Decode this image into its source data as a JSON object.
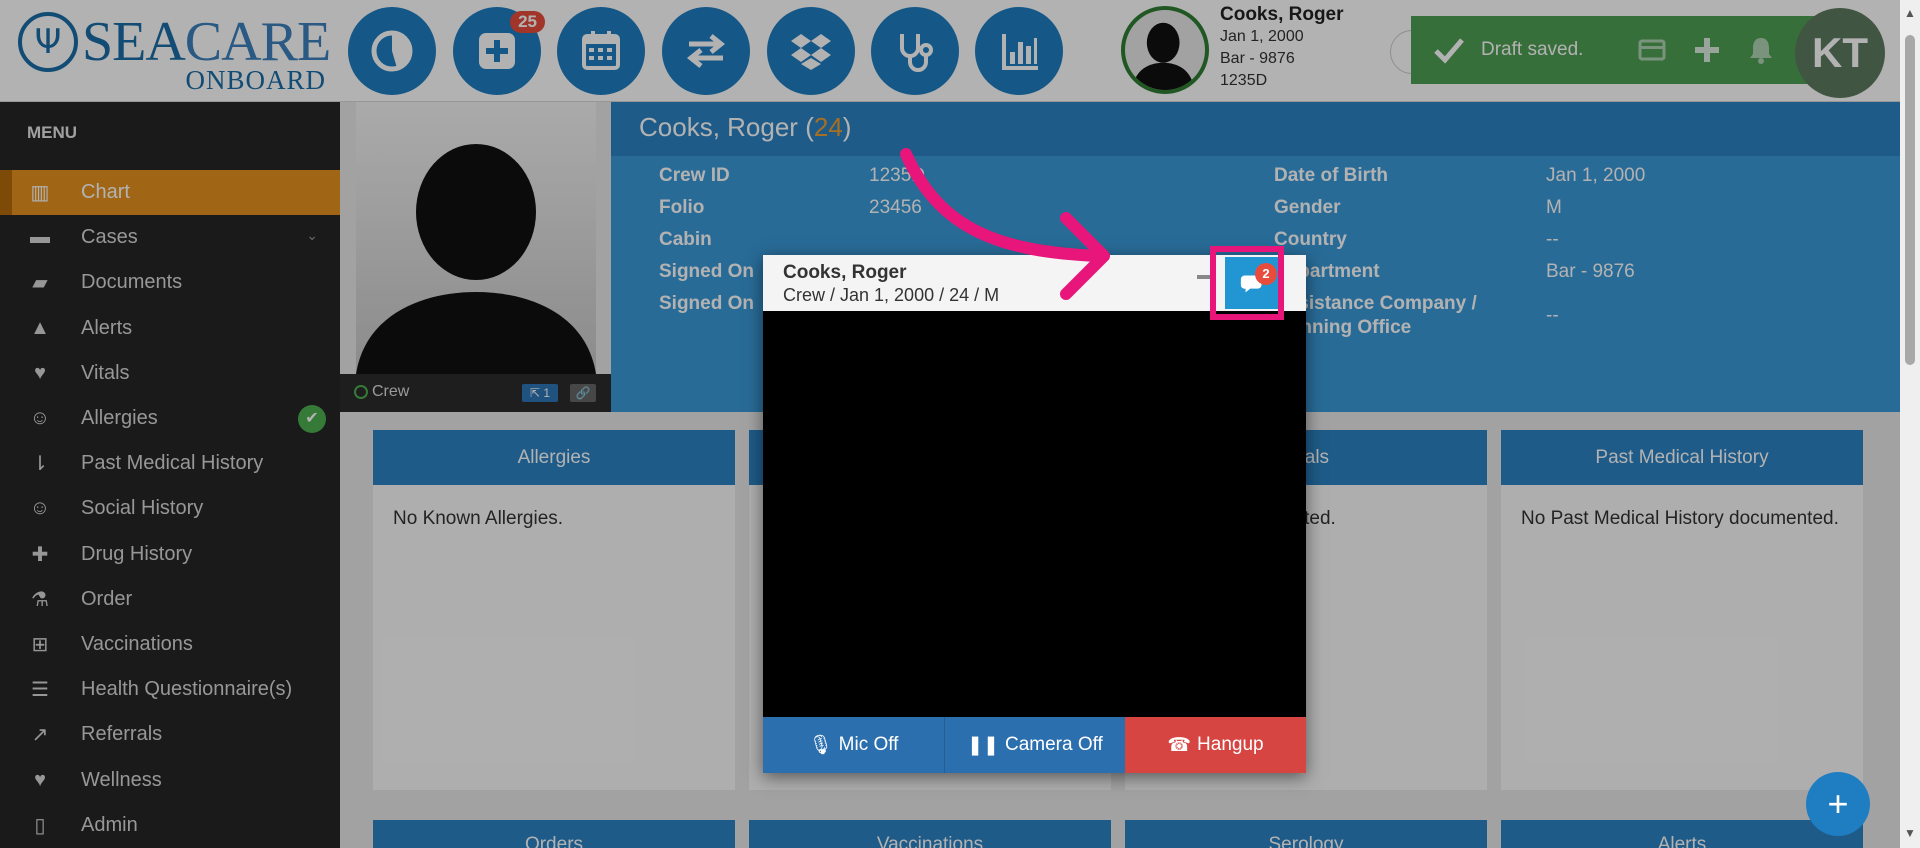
{
  "brand": {
    "name_bold": "SEA",
    "name_light": "CARE",
    "sub": "ONBOARD"
  },
  "nav": {
    "buttons": [
      {
        "icon": "dashboard-icon"
      },
      {
        "icon": "add-case-icon",
        "badge": "25"
      },
      {
        "icon": "calendar-icon"
      },
      {
        "icon": "transfer-icon"
      },
      {
        "icon": "dropbox-icon"
      },
      {
        "icon": "stethoscope-icon"
      },
      {
        "icon": "bar-chart-icon"
      }
    ]
  },
  "patient_header": {
    "name": "Cooks, Roger",
    "dob": "Jan 1, 2000",
    "dept": "Bar - 9876",
    "crew_id": "1235D"
  },
  "toast": {
    "message": "Draft saved."
  },
  "user": {
    "initials": "KT"
  },
  "sidebar": {
    "title": "MENU",
    "items": [
      {
        "label": "Chart",
        "icon": "bar-chart-icon",
        "active": true
      },
      {
        "label": "Cases",
        "icon": "archive-icon",
        "expand": true
      },
      {
        "label": "Documents",
        "icon": "folder-icon"
      },
      {
        "label": "Alerts",
        "icon": "warning-icon"
      },
      {
        "label": "Vitals",
        "icon": "heart-icon"
      },
      {
        "label": "Allergies",
        "icon": "smile-icon",
        "check": true
      },
      {
        "label": "Past Medical History",
        "icon": "sort-icon"
      },
      {
        "label": "Social History",
        "icon": "smile-icon"
      },
      {
        "label": "Drug History",
        "icon": "medkit-icon"
      },
      {
        "label": "Order",
        "icon": "flask-icon"
      },
      {
        "label": "Vaccinations",
        "icon": "plus-square-icon"
      },
      {
        "label": "Health Questionnaire(s)",
        "icon": "list-icon"
      },
      {
        "label": "Referrals",
        "icon": "share-icon"
      },
      {
        "label": "Wellness",
        "icon": "heartbeat-icon"
      },
      {
        "label": "Admin",
        "icon": "file-icon"
      }
    ]
  },
  "photo_bar": {
    "status": "Crew",
    "badge1": "1",
    "badge2": ""
  },
  "profile": {
    "name": "Cooks, Roger",
    "age": "24",
    "left_fields": [
      {
        "key": "Crew ID",
        "value": "1235D"
      },
      {
        "key": "Folio",
        "value": "23456"
      },
      {
        "key": "Cabin",
        "value": ""
      },
      {
        "key": "Signed On",
        "value": ""
      },
      {
        "key": "Signed On",
        "value": ""
      }
    ],
    "right_fields": [
      {
        "key": "Date of Birth",
        "value": "Jan 1, 2000"
      },
      {
        "key": "Gender",
        "value": "M"
      },
      {
        "key": "Country",
        "value": "--"
      },
      {
        "key": "Department",
        "value": "Bar - 9876"
      },
      {
        "key": "Assistance Company / Manning Office",
        "value": "--"
      }
    ]
  },
  "cards": [
    {
      "title": "Allergies",
      "body": "No Known Allergies."
    },
    {
      "title": "",
      "body": ""
    },
    {
      "title": "Vitals",
      "body": "No Vitals documented."
    },
    {
      "title": "Past Medical History",
      "body": "No Past Medical History documented."
    }
  ],
  "cards_row2": [
    "Orders",
    "Vaccinations",
    "Serology",
    "Alerts"
  ],
  "video": {
    "name": "Cooks, Roger",
    "subtitle": "Crew / Jan 1, 2000 / 24 / M",
    "chat_count": "2",
    "mic_label": "Mic Off",
    "camera_label": "Camera Off",
    "hangup_label": "Hangup"
  },
  "colors": {
    "primary": "#1f7dc1",
    "accent": "#e6921f",
    "highlight": "#e8157a",
    "danger": "#d64541",
    "success": "#4f9f55"
  }
}
